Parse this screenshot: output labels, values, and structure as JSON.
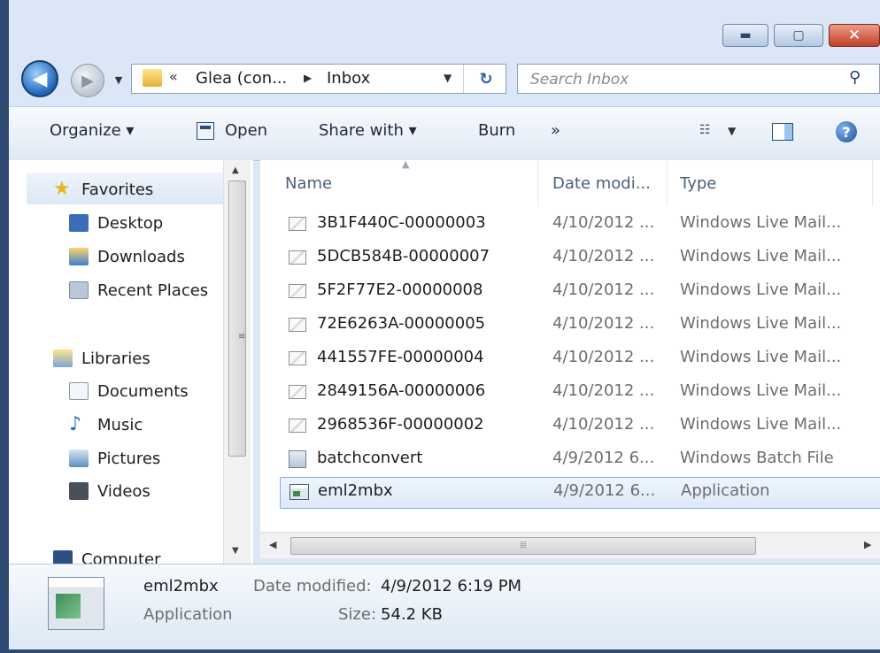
{
  "window": {
    "caption_buttons": {
      "minimize": "▬",
      "maximize": "▢",
      "close": "✕"
    }
  },
  "nav": {
    "back_glyph": "◀",
    "forward_glyph": "▶",
    "history_drop": "▼",
    "address": {
      "chevron": "«",
      "segments": [
        "Glea (con...",
        "Inbox"
      ],
      "separator": "▶",
      "dropdown": "▼",
      "refresh_glyph": "↻"
    },
    "search": {
      "placeholder": "Search Inbox",
      "icon_glyph": "⚲"
    }
  },
  "toolbar": {
    "organize": "Organize ▾",
    "open": "Open",
    "share_with": "Share with ▾",
    "burn": "Burn",
    "more": "»",
    "view_drop": "▼",
    "help": "?"
  },
  "sidebar": {
    "favorites": "Favorites",
    "items": [
      {
        "label": "Desktop",
        "color": "#3a6fb8"
      },
      {
        "label": "Downloads",
        "color": "#3a7fd2"
      },
      {
        "label": "Recent Places",
        "color": "#8aa0b8"
      }
    ],
    "libraries": "Libraries",
    "lib_items": [
      {
        "label": "Documents",
        "color": "#c9d6e6"
      },
      {
        "label": "Music",
        "color": "#2a6fcf"
      },
      {
        "label": "Pictures",
        "color": "#5c8ec2"
      },
      {
        "label": "Videos",
        "color": "#4a4f5c"
      }
    ],
    "computer": "Computer"
  },
  "list": {
    "columns": {
      "name": "Name",
      "date": "Date modi...",
      "type": "Type"
    },
    "rows": [
      {
        "name": "3B1F440C-00000003",
        "date": "4/10/2012 ...",
        "type": "Windows Live Mail..."
      },
      {
        "name": "5DCB584B-00000007",
        "date": "4/10/2012 ...",
        "type": "Windows Live Mail..."
      },
      {
        "name": "5F2F77E2-00000008",
        "date": "4/10/2012 ...",
        "type": "Windows Live Mail..."
      },
      {
        "name": "72E6263A-00000005",
        "date": "4/10/2012 ...",
        "type": "Windows Live Mail..."
      },
      {
        "name": "441557FE-00000004",
        "date": "4/10/2012 ...",
        "type": "Windows Live Mail..."
      },
      {
        "name": "2849156A-00000006",
        "date": "4/10/2012 ...",
        "type": "Windows Live Mail..."
      },
      {
        "name": "2968536F-00000002",
        "date": "4/10/2012 ...",
        "type": "Windows Live Mail..."
      },
      {
        "name": "batchconvert",
        "date": "4/9/2012 6...",
        "type": "Windows Batch File"
      },
      {
        "name": "eml2mbx",
        "date": "4/9/2012 6...",
        "type": "Application"
      }
    ],
    "selected_index": 8
  },
  "details": {
    "name": "eml2mbx",
    "type": "Application",
    "date_label": "Date modified:",
    "date_value": "4/9/2012 6:19 PM",
    "size_label": "Size:",
    "size_value": "54.2 KB"
  }
}
